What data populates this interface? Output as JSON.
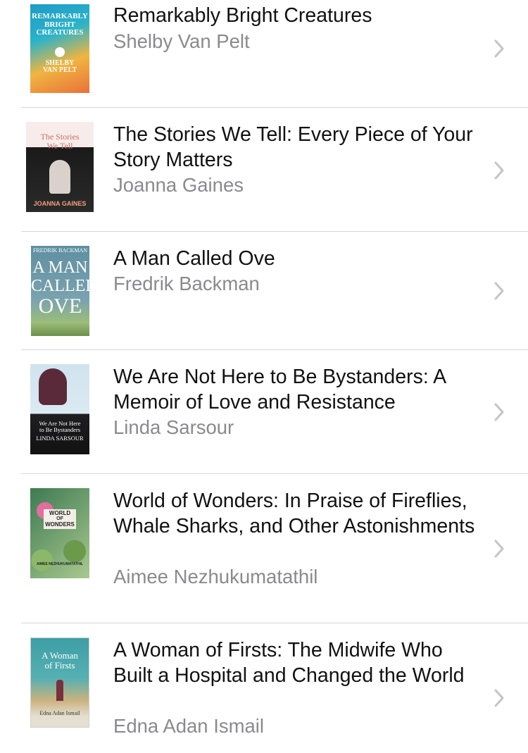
{
  "books": [
    {
      "title": "Remarkably Bright Creatures",
      "author": "Shelby Van Pelt",
      "cover_text": [
        "REMARKABLY",
        "BRIGHT",
        "CREATURES",
        "SHELBY",
        "VAN PELT"
      ]
    },
    {
      "title": "The Stories We Tell: Every Piece of Your Story Matters",
      "author": "Joanna Gaines",
      "cover_text": [
        "The Stories",
        "We Tell",
        "JOANNA GAINES"
      ]
    },
    {
      "title": "A Man Called Ove",
      "author": "Fredrik Backman",
      "cover_text": [
        "FREDRIK BACKMAN",
        "A MAN",
        "CALLED",
        "OVE"
      ]
    },
    {
      "title": "We Are Not Here to Be Bystanders: A Memoir of Love and Resistance",
      "author": "Linda Sarsour",
      "cover_text": [
        "We Are Not Here",
        "to Be Bystanders",
        "LINDA SARSOUR"
      ]
    },
    {
      "title": "World of Wonders: In Praise of Fireflies, Whale Sharks, and Other Astonishments",
      "author": "Aimee Nezhukumatathil",
      "cover_text": [
        "WORLD",
        "OF",
        "WONDERS",
        "AIMEE NEZHUKUMATATHIL"
      ]
    },
    {
      "title": "A Woman of Firsts: The Midwife Who Built a Hospital and Changed the World",
      "author": "Edna Adan Ismail",
      "cover_text": [
        "A Woman",
        "of Firsts",
        "Edna Adan Ismail"
      ]
    }
  ],
  "icons": {
    "disclosure": "chevron-right-icon"
  },
  "colors": {
    "title": "#111111",
    "author": "#8a8a8e",
    "separator": "#d6d6d8",
    "chevron": "#c4c4c7"
  }
}
